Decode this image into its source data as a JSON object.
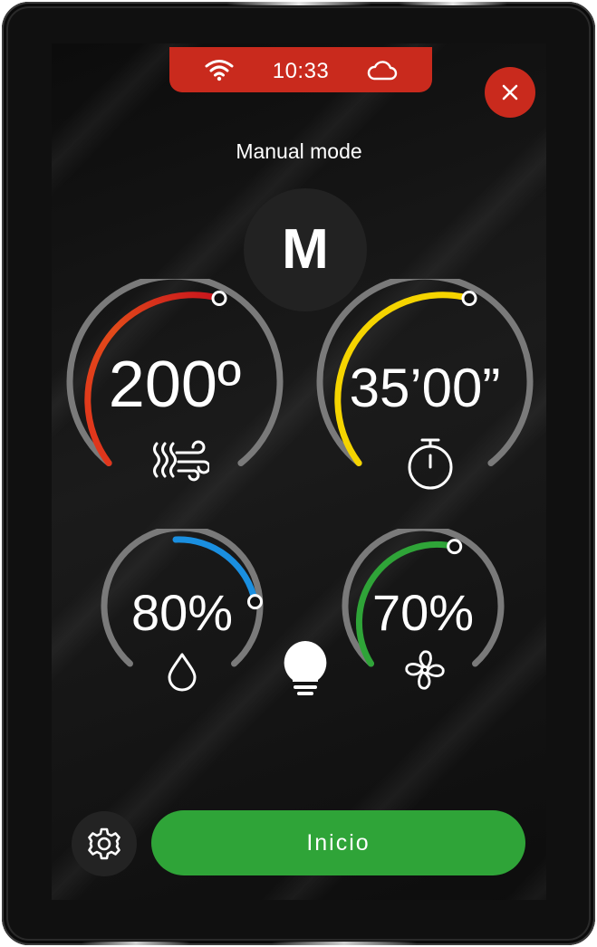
{
  "status_bar": {
    "time": "10:33",
    "background_color": "#c92a1d",
    "icons": [
      "wifi-icon",
      "cloud-icon"
    ]
  },
  "close_button": {
    "icon": "close-icon",
    "color": "#c92a1d"
  },
  "mode": {
    "title": "Manual mode",
    "letter": "M"
  },
  "gauges": [
    {
      "id": "temperature",
      "value": "200º",
      "icon": "heat-airflow-icon",
      "accent": "#e0321c",
      "level": 0.55
    },
    {
      "id": "timer",
      "value": "35’00”",
      "icon": "stopwatch-icon",
      "accent": "#f5d400",
      "level": 0.55
    },
    {
      "id": "humidity",
      "value": "80%",
      "icon": "water-drop-icon",
      "accent": "#1a8fe0",
      "level": 0.8
    },
    {
      "id": "fan",
      "value": "70%",
      "icon": "fan-icon",
      "accent": "#2fa438",
      "level": 0.7
    }
  ],
  "light": {
    "icon": "light-bulb-icon"
  },
  "settings_button": {
    "icon": "gear-icon"
  },
  "start_button": {
    "label": "Inicio",
    "color": "#2fa438"
  }
}
